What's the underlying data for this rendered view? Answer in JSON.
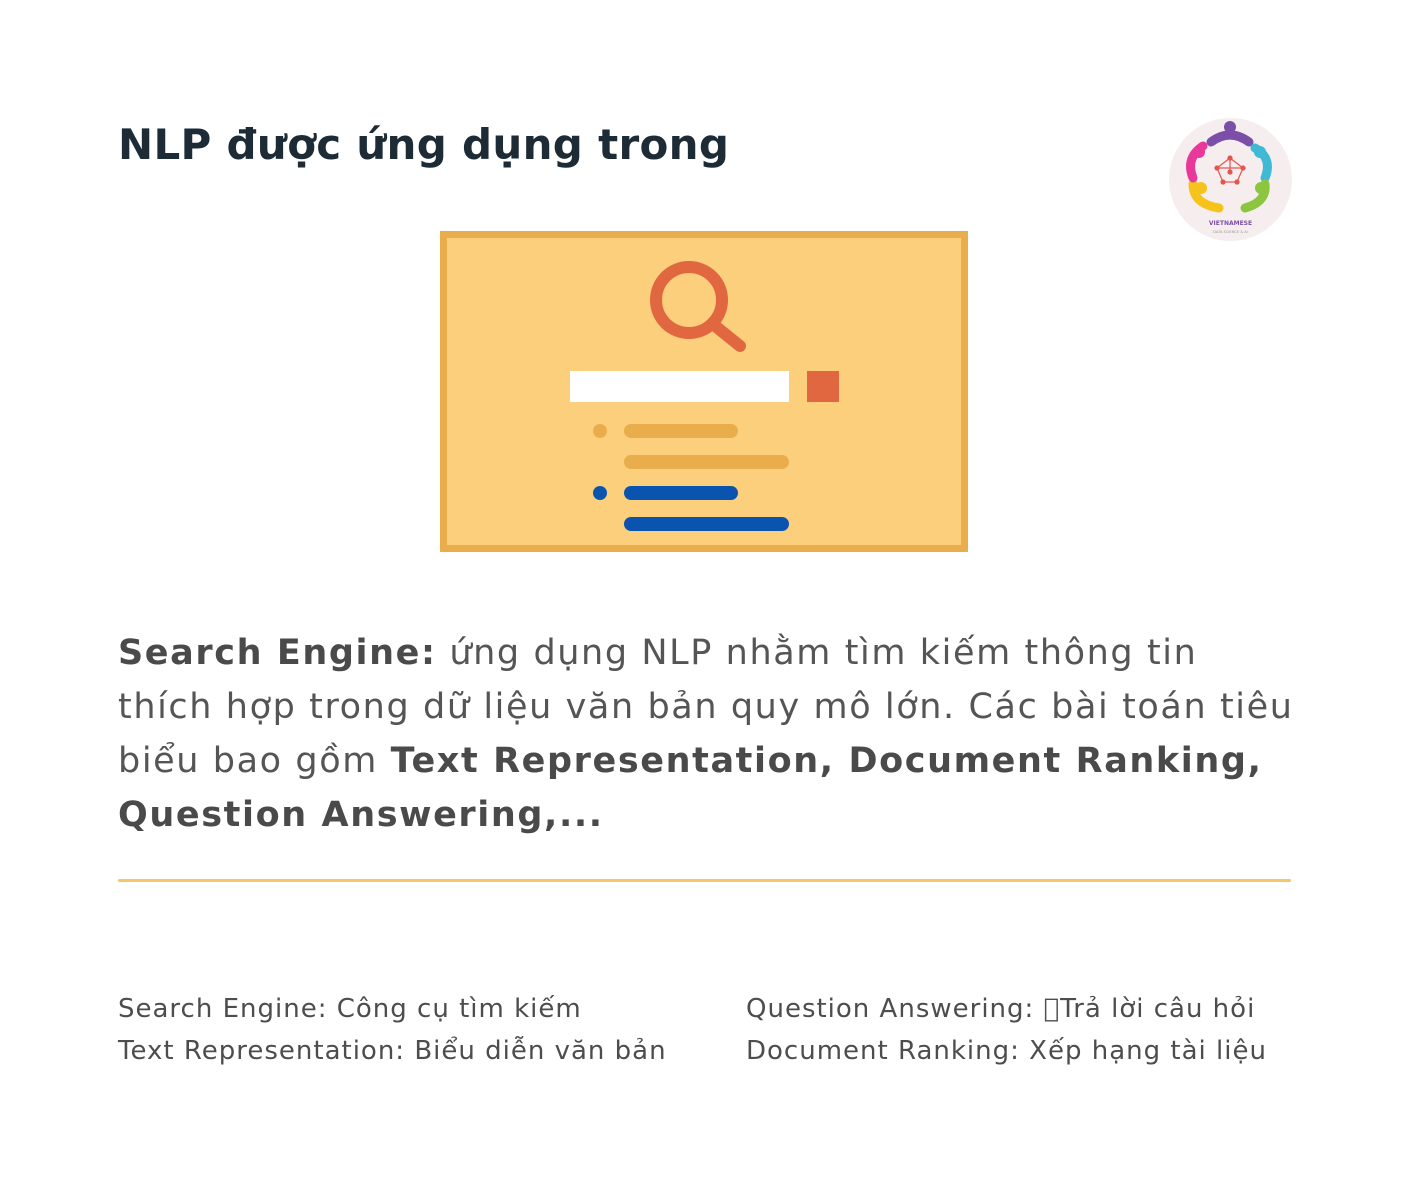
{
  "title": "NLP được ứng dụng trong",
  "logo": {
    "text": "VIETNAMESE",
    "subtext": "DATA SCIENCE & AI",
    "colors": [
      "#7b4fa8",
      "#40b9d4",
      "#8cc63f",
      "#f6c21c",
      "#e8389a"
    ]
  },
  "illustration": {
    "icon": "magnifier-icon",
    "card_color": "#fbcf7b",
    "border_color": "#e9ad4c",
    "accent_color": "#e0673f",
    "result_color": "#0a54b0"
  },
  "paragraph": {
    "term1": "Search Engine:",
    "text1": " ứng dụng NLP nhằm tìm kiếm thông tin thích hợp trong dữ liệu văn bản quy mô lớn. Các bài toán tiêu biểu bao gồm ",
    "term2": "Text Representation, Document Ranking, Question Answering,..."
  },
  "glossary": {
    "left": [
      "Search Engine: Công cụ tìm kiếm",
      "Text Representation: Biểu diễn văn bản"
    ],
    "right": [
      "Question Answering: \u0000Trả lời câu hỏi",
      "Document Ranking: Xếp hạng tài liệu"
    ]
  }
}
